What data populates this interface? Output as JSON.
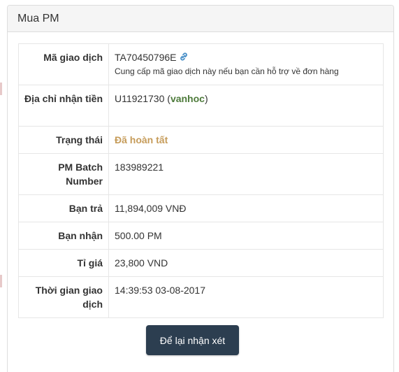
{
  "panel": {
    "title": "Mua PM"
  },
  "rows": {
    "transaction_id": {
      "label": "Mã giao dịch",
      "value": "TA70450796E",
      "hint": "Cung cấp mã giao dịch này nếu bạn cần hỗ trợ về đơn hàng"
    },
    "receive_address": {
      "label": "Địa chỉ nhận tiền",
      "account": "U11921730",
      "open_paren": "(",
      "account_name": "vanhoc",
      "close_paren": ")"
    },
    "status": {
      "label": "Trạng thái",
      "value": "Đã hoàn tất"
    },
    "batch": {
      "label": "PM Batch Number",
      "value": "183989221"
    },
    "you_pay": {
      "label": "Bạn trả",
      "value": "11,894,009 VNĐ"
    },
    "you_receive": {
      "label": "Bạn nhận",
      "value": "500.00 PM"
    },
    "rate": {
      "label": "Tỉ giá",
      "value": "23,800 VND"
    },
    "time": {
      "label": "Thời gian giao dịch",
      "value": "14:39:53 03-08-2017"
    }
  },
  "actions": {
    "feedback_label": "Để lại nhận xét"
  },
  "icons": {
    "transaction_link": "link-icon"
  },
  "colors": {
    "account_name": "#4d7a3a",
    "status_complete": "#c69c5a",
    "button_bg": "#2c3e50",
    "link_icon": "#4a90c8"
  }
}
